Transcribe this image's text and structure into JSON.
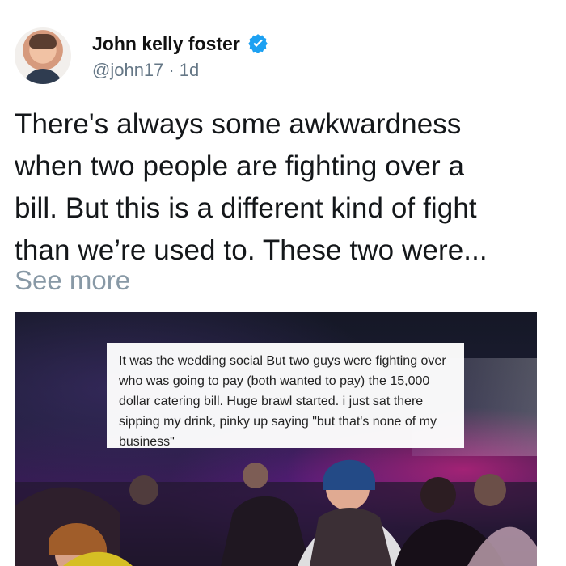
{
  "tweet": {
    "display_name": "John kelly foster",
    "handle": "@john17",
    "separator": "·",
    "time": "1d",
    "text_lines": [
      "There's always some awkwardness",
      "when two people are fighting over a",
      "bill. But this is a different kind of fight",
      "than we’re used to. These two were..."
    ],
    "see_more": "See more"
  },
  "image": {
    "caption": "It was the wedding social But two guys were fighting over who was going to pay (both wanted to pay) the 15,000 dollar catering bill. Huge brawl started. i just sat there sipping my drink, pinky up saying \"but that's none of my business\""
  },
  "icons": {
    "verified": "verified-badge-icon"
  },
  "colors": {
    "verified": "#1da1f2",
    "meta": "#657786",
    "see_more": "#8899a6"
  }
}
